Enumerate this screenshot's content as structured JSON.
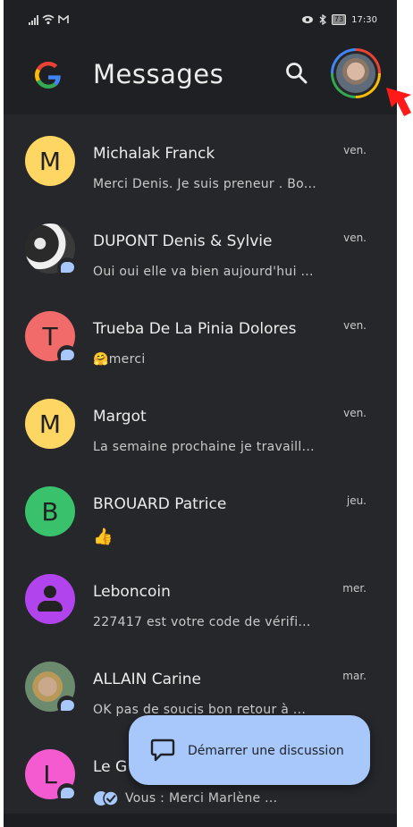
{
  "status_bar": {
    "time": "17:30",
    "battery": "73",
    "left_icons": [
      "signal-icon",
      "wifi-icon",
      "gmail-icon"
    ],
    "right_icons": [
      "eye-icon",
      "bluetooth-icon",
      "battery-icon"
    ]
  },
  "app_bar": {
    "title": "Messages",
    "logo": "google-g-icon",
    "search_icon": "search-icon",
    "account_icon": "account-avatar"
  },
  "conversations": [
    {
      "name": "Michalak Franck",
      "snippet": "Merci Denis. Je suis preneur . Bo...",
      "date": "ven.",
      "avatar_letter": "M",
      "avatar_color": "#fdd663",
      "avatar_type": "letter",
      "badge": false
    },
    {
      "name": "DUPONT Denis & Sylvie",
      "snippet": "Oui oui elle va bien aujourd'hui ...",
      "date": "ven.",
      "avatar_letter": "",
      "avatar_color": "",
      "avatar_type": "photo",
      "badge": true
    },
    {
      "name": "Trueba De La Pinia Dolores",
      "snippet": "🤗merci",
      "date": "ven.",
      "avatar_letter": "T",
      "avatar_color": "#f16b6b",
      "avatar_type": "letter",
      "badge": true
    },
    {
      "name": "Margot",
      "snippet": "La semaine prochaine je travaill...",
      "date": "ven.",
      "avatar_letter": "M",
      "avatar_color": "#fdd663",
      "avatar_type": "letter",
      "badge": false
    },
    {
      "name": "BROUARD Patrice",
      "snippet": "👍",
      "date": "jeu.",
      "avatar_letter": "B",
      "avatar_color": "#39c16c",
      "avatar_type": "letter",
      "badge": false
    },
    {
      "name": "Leboncoin",
      "snippet": "227417 est votre code de vérifi...",
      "date": "mer.",
      "avatar_letter": "",
      "avatar_color": "#b144ec",
      "avatar_type": "person",
      "badge": false
    },
    {
      "name": "ALLAIN Carine",
      "snippet": "OK pas de soucis bon retour à ...",
      "date": "mar.",
      "avatar_letter": "",
      "avatar_color": "",
      "avatar_type": "photo",
      "badge": true
    },
    {
      "name": "Le G",
      "snippet": "Vous : Merci Marlène ...",
      "date": "",
      "avatar_letter": "L",
      "avatar_color": "#f55bd1",
      "avatar_type": "letter",
      "badge": true
    }
  ],
  "fab": {
    "label": "Démarrer une discussion",
    "icon": "chat-bubble-icon",
    "color": "#a8c7fa"
  },
  "colors": {
    "background": "#26272b",
    "app_bar": "#1f2024",
    "annotation_arrow": "#ff0000"
  }
}
